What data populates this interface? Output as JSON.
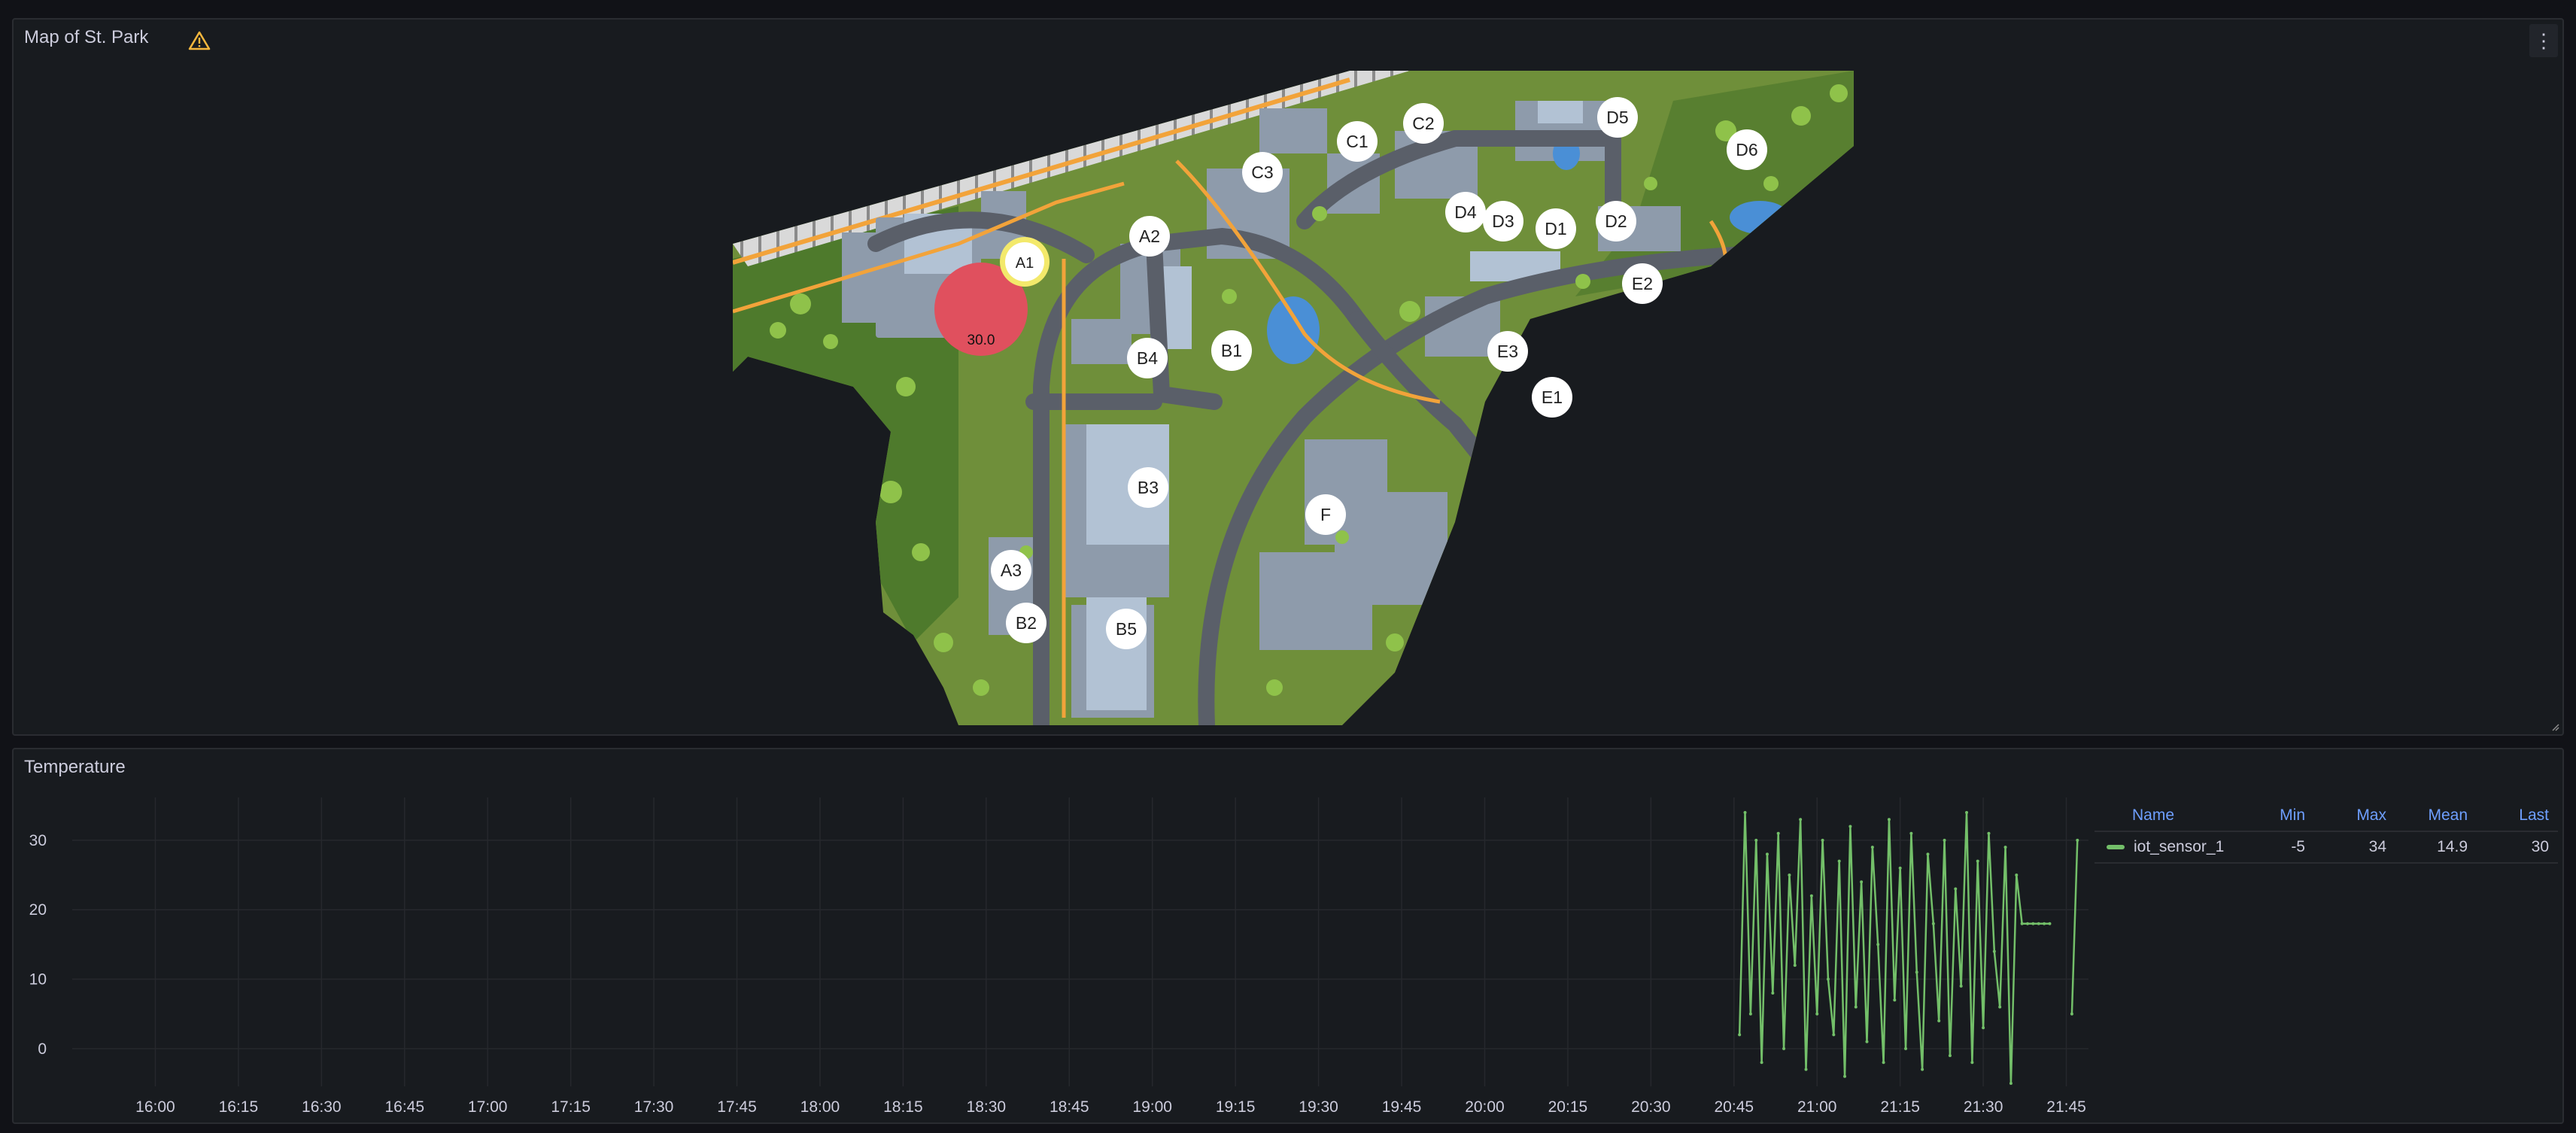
{
  "map_panel": {
    "title": "Map of St. Park",
    "warning_icon": "warning-triangle-icon",
    "menu_icon": "vertical-ellipsis-icon",
    "menu_glyph": "⋮",
    "markers": [
      "A1",
      "A2",
      "A3",
      "B1",
      "B2",
      "B3",
      "B4",
      "B5",
      "C1",
      "C2",
      "C3",
      "D1",
      "D2",
      "D3",
      "D4",
      "D5",
      "D6",
      "E1",
      "E2",
      "E3",
      "F"
    ],
    "highlighted_marker": "A1",
    "heat_circle": {
      "value": "30.0",
      "color": "#e0505e"
    }
  },
  "temperature_panel": {
    "title": "Temperature",
    "legend": {
      "headers": {
        "name": "Name",
        "min": "Min",
        "max": "Max",
        "mean": "Mean",
        "last": "Last"
      },
      "rows": [
        {
          "name": "iot_sensor_1",
          "min": "-5",
          "max": "34",
          "mean": "14.9",
          "last": "30",
          "color": "#73bf69"
        }
      ]
    }
  },
  "chart_data": {
    "type": "line",
    "x_ticks": [
      "16:00",
      "16:15",
      "16:30",
      "16:45",
      "17:00",
      "17:15",
      "17:30",
      "17:45",
      "18:00",
      "18:15",
      "18:30",
      "18:45",
      "19:00",
      "19:15",
      "19:30",
      "19:45",
      "20:00",
      "20:15",
      "20:30",
      "20:45",
      "21:00",
      "21:15",
      "21:30",
      "21:45"
    ],
    "y_ticks": [
      0,
      10,
      20,
      30
    ],
    "ylim": [
      -5,
      34
    ],
    "series": [
      {
        "name": "iot_sensor_1",
        "color": "#73bf69",
        "x": [
          "20:46",
          "20:47",
          "20:48",
          "20:49",
          "20:50",
          "20:51",
          "20:52",
          "20:53",
          "20:54",
          "20:55",
          "20:56",
          "20:57",
          "20:58",
          "20:59",
          "21:00",
          "21:01",
          "21:02",
          "21:03",
          "21:04",
          "21:05",
          "21:06",
          "21:07",
          "21:08",
          "21:09",
          "21:10",
          "21:11",
          "21:12",
          "21:13",
          "21:14",
          "21:15",
          "21:16",
          "21:17",
          "21:18",
          "21:19",
          "21:20",
          "21:21",
          "21:22",
          "21:23",
          "21:24",
          "21:25",
          "21:26",
          "21:27",
          "21:28",
          "21:29",
          "21:30",
          "21:31",
          "21:32",
          "21:33",
          "21:34",
          "21:35",
          "21:36",
          "21:37",
          "21:38",
          "21:39",
          "21:40",
          "21:41",
          "21:42",
          "21:46",
          "21:47"
        ],
        "values": [
          2,
          34,
          5,
          30,
          -2,
          28,
          8,
          31,
          0,
          25,
          12,
          33,
          -3,
          22,
          5,
          30,
          10,
          2,
          27,
          -4,
          32,
          6,
          24,
          1,
          29,
          15,
          -2,
          33,
          7,
          26,
          0,
          31,
          11,
          -3,
          28,
          18,
          4,
          30,
          -1,
          23,
          9,
          34,
          -2,
          27,
          3,
          31,
          14,
          6,
          29,
          -5,
          25,
          18,
          18,
          18,
          18,
          18,
          18,
          5,
          30
        ]
      }
    ]
  }
}
